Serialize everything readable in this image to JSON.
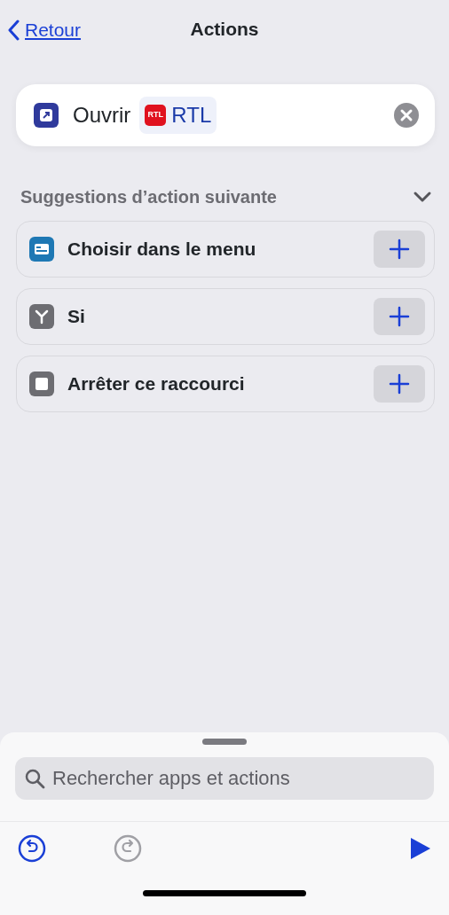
{
  "nav": {
    "back_label": "Retour",
    "title": "Actions"
  },
  "action": {
    "verb": "Ouvrir",
    "app_logo_text": "RTL",
    "app_name": "RTL"
  },
  "suggestions": {
    "title": "Suggestions d’action suivante",
    "expanded": true,
    "items": [
      {
        "kind": "menu",
        "label": "Choisir dans le menu"
      },
      {
        "kind": "if",
        "label": "Si"
      },
      {
        "kind": "stop",
        "label": "Arrêter ce raccourci"
      }
    ]
  },
  "search": {
    "placeholder": "Rechercher apps et actions"
  },
  "toolbar": {
    "undo_disabled": false,
    "redo_disabled": true
  }
}
